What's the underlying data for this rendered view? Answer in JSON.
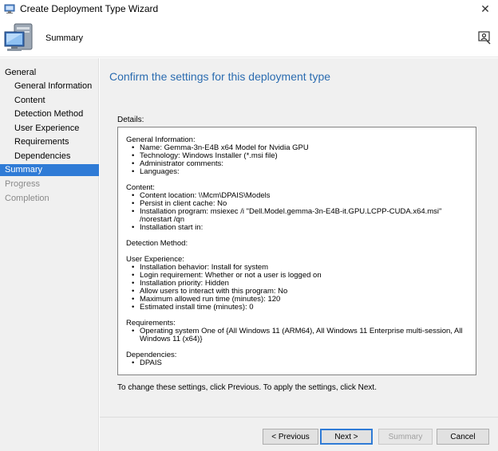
{
  "window": {
    "title": "Create Deployment Type Wizard",
    "close_glyph": "✕"
  },
  "banner": {
    "page_label": "Summary"
  },
  "sidebar": {
    "items": [
      {
        "label": "General"
      },
      {
        "label": "General Information"
      },
      {
        "label": "Content"
      },
      {
        "label": "Detection Method"
      },
      {
        "label": "User Experience"
      },
      {
        "label": "Requirements"
      },
      {
        "label": "Dependencies"
      },
      {
        "label": "Summary"
      },
      {
        "label": "Progress"
      },
      {
        "label": "Completion"
      }
    ]
  },
  "main": {
    "heading": "Confirm the settings for this deployment type",
    "details_label": "Details:",
    "sections": [
      {
        "title": "General Information:",
        "items": [
          "Name: Gemma-3n-E4B x64 Model for Nvidia GPU",
          "Technology: Windows Installer (*.msi file)",
          "Administrator comments:",
          "Languages:"
        ]
      },
      {
        "title": "Content:",
        "items": [
          "Content location: \\\\Mcm\\DPAIS\\Models",
          "Persist in client cache: No",
          "Installation program: msiexec /i \"Dell.Model.gemma-3n-E4B-it.GPU.LCPP-CUDA.x64.msi\" /norestart /qn",
          "Installation start in:"
        ]
      },
      {
        "title": "Detection Method:",
        "items": []
      },
      {
        "title": "User Experience:",
        "items": [
          "Installation behavior: Install for system",
          "Login requirement: Whether or not a user is logged on",
          "Installation priority: Hidden",
          "Allow users to interact with this program: No",
          "Maximum allowed run time (minutes): 120",
          "Estimated install time (minutes): 0"
        ]
      },
      {
        "title": "Requirements:",
        "items": [
          "Operating system  One of  {All Windows 11 (ARM64), All Windows 11 Enterprise multi-session, All Windows 11 (x64)}"
        ]
      },
      {
        "title": "Dependencies:",
        "items": [
          "DPAIS"
        ]
      }
    ],
    "hint": "To change these settings, click Previous. To apply the settings, click Next."
  },
  "buttons": {
    "previous": "< Previous",
    "next": "Next >",
    "summary": "Summary",
    "cancel": "Cancel"
  },
  "colors": {
    "accent": "#2f7bd6",
    "heading": "#2b6cb0"
  }
}
